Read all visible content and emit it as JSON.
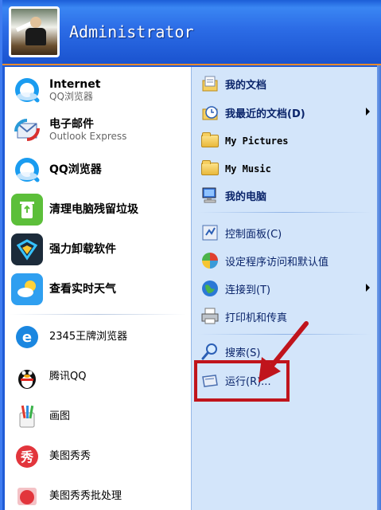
{
  "user": {
    "name": "Administrator"
  },
  "left_items": [
    {
      "label": "Internet",
      "sublabel": "QQ浏览器",
      "icon": "qq-browser-icon"
    },
    {
      "label": "电子邮件",
      "sublabel": "Outlook Express",
      "icon": "outlook-express-icon"
    },
    {
      "label": "QQ浏览器",
      "icon": "qq-browser-icon"
    },
    {
      "label": "清理电脑残留垃圾",
      "icon": "recycle-bin-icon"
    },
    {
      "label": "强力卸载软件",
      "icon": "uninstaller-icon"
    },
    {
      "label": "查看实时天气",
      "icon": "weather-icon"
    },
    {
      "label": "2345王牌浏览器",
      "icon": "browser-2345-icon"
    },
    {
      "label": "腾讯QQ",
      "icon": "qq-penguin-icon"
    },
    {
      "label": "画图",
      "icon": "paint-icon"
    },
    {
      "label": "美图秀秀",
      "icon": "meitu-icon"
    },
    {
      "label": "美图秀秀批处理",
      "icon": "meitu-batch-icon"
    }
  ],
  "right_items": [
    {
      "label": "我的文档",
      "icon": "my-documents-icon"
    },
    {
      "label": "我最近的文档(D)",
      "icon": "recent-documents-icon",
      "has_submenu": true
    },
    {
      "label": "My Pictures",
      "icon": "folder-icon"
    },
    {
      "label": "My Music",
      "icon": "folder-icon"
    },
    {
      "label": "我的电脑",
      "icon": "my-computer-icon"
    },
    {
      "label": "控制面板(C)",
      "icon": "control-panel-icon"
    },
    {
      "label": "设定程序访问和默认值",
      "icon": "program-defaults-icon"
    },
    {
      "label": "连接到(T)",
      "icon": "connect-to-icon",
      "has_submenu": true
    },
    {
      "label": "打印机和传真",
      "icon": "printer-icon"
    },
    {
      "label": "搜索(S)",
      "icon": "search-icon"
    },
    {
      "label": "运行(R)...",
      "icon": "run-icon"
    }
  ],
  "colors": {
    "header_blue": "#2c6ce6",
    "right_pane": "#d3e5fa",
    "annotation_red": "#c0141c",
    "header_divider": "#e98b2d"
  }
}
